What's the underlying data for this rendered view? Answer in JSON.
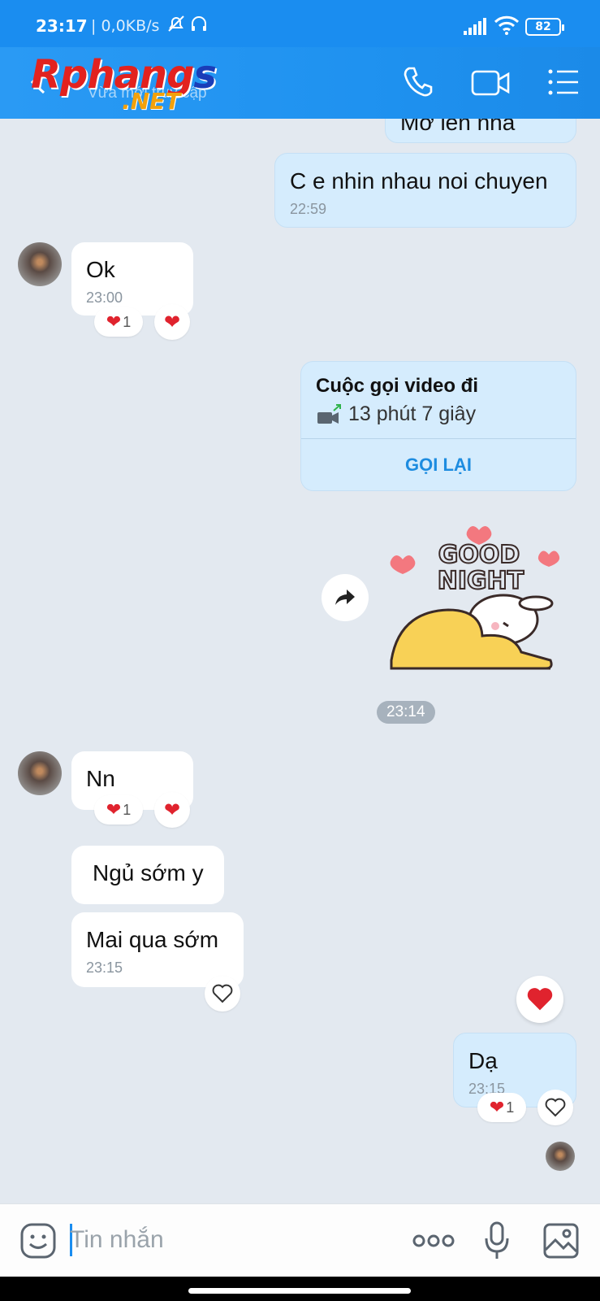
{
  "status_bar": {
    "time": "23:17",
    "speed": "| 0,0KB/s",
    "battery": "82"
  },
  "header": {
    "logo_part1": "Rphang",
    "logo_part2": "s",
    "logo_net": ".NET",
    "subtitle": "Vừa mới truy cập"
  },
  "messages": {
    "partial_top": "Mở lên nha",
    "m1": {
      "text": "C e nhin nhau noi chuyen",
      "time": "22:59"
    },
    "m2": {
      "text": "Ok",
      "time": "23:00",
      "reaction_count": "1"
    },
    "call": {
      "title": "Cuộc gọi video đi",
      "duration": "13 phút 7 giây",
      "action": "GỌI LẠI"
    },
    "sticker": {
      "line1": "GOOD",
      "line2": "NIGHT"
    },
    "time_chip": "23:14",
    "m3": {
      "text": "Nn",
      "reaction_count": "1"
    },
    "m4": {
      "text": "Ngủ sớm y"
    },
    "m5": {
      "text": "Mai qua sớm",
      "time": "23:15"
    },
    "m6": {
      "text": "Dạ",
      "time": "23:15",
      "reaction_count": "1"
    }
  },
  "input": {
    "placeholder": "Tin nhắn"
  },
  "colors": {
    "accent": "#1a8df0",
    "bubble_out": "#d5ecfd",
    "heart": "#e0232e"
  }
}
